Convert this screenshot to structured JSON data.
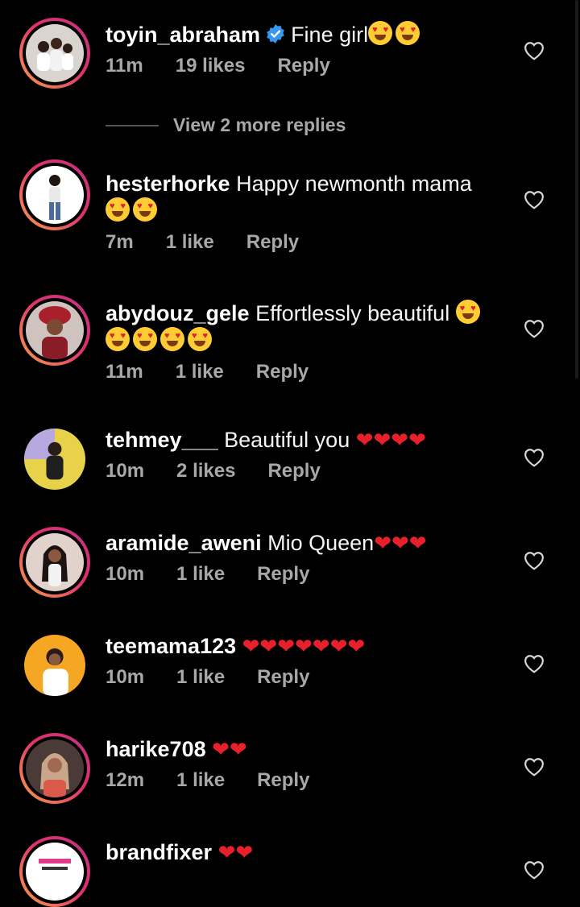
{
  "comments": [
    {
      "username": "toyin_abraham",
      "verified": true,
      "text": "Fine girl",
      "emoji_line1": "face,face",
      "emoji_line2": "",
      "time": "11m",
      "likes": "19 likes",
      "reply": "Reply"
    },
    {
      "username": "hesterhorke",
      "text": "Happy newmonth mama",
      "time": "7m",
      "likes": "1 like",
      "reply": "Reply"
    },
    {
      "username": "abydouz_gele",
      "text": "Effortlessly beautiful",
      "time": "11m",
      "likes": "1 like",
      "reply": "Reply"
    },
    {
      "username": "tehmey___",
      "text": "Beautiful you",
      "hearts": "❤❤❤❤",
      "time": "10m",
      "likes": "2 likes",
      "reply": "Reply"
    },
    {
      "username": "aramide_aweni",
      "text": "Mio Queen",
      "hearts": "❤❤❤",
      "time": "10m",
      "likes": "1 like",
      "reply": "Reply"
    },
    {
      "username": "teemama123",
      "text": "",
      "hearts": "❤❤❤❤❤❤❤",
      "time": "10m",
      "likes": "1 like",
      "reply": "Reply"
    },
    {
      "username": "harike708",
      "text": "",
      "hearts": "❤❤",
      "time": "12m",
      "likes": "1 like",
      "reply": "Reply"
    },
    {
      "username": "brandfixer",
      "text": "",
      "hearts": "❤❤"
    }
  ],
  "view_replies": "View 2 more replies",
  "colors": {
    "background": "#000000",
    "meta_text": "#a8a8a8",
    "verified_blue": "#3897f0",
    "heart_red": "#e8202a"
  },
  "icons": {
    "like": "heart-outline-icon",
    "verified": "verified-badge-icon"
  }
}
